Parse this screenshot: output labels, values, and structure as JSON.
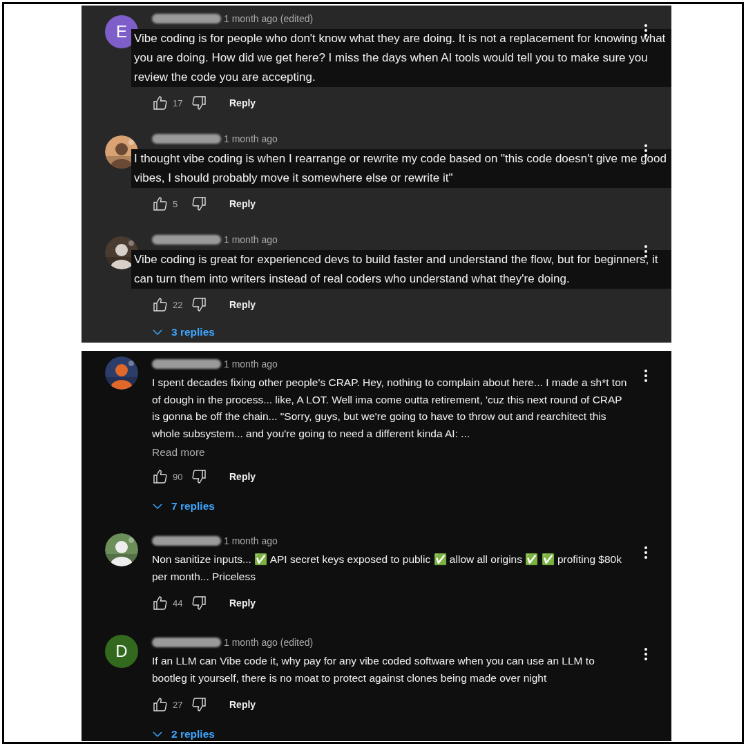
{
  "panels": [
    {
      "kind": "highlighted",
      "comments": [
        {
          "avatar": {
            "kind": "letter",
            "letter": "E",
            "color": "#7e5fc9"
          },
          "time": "1 month ago (edited)",
          "text": "Vibe coding is for people who don't know what they are doing. It is not a replacement for knowing what you are doing. How did we get here? I miss the days when AI tools would tell you to make sure you review the code you are accepting.",
          "likes": "17",
          "reply": "Reply"
        },
        {
          "time": "1 month ago",
          "text": "I thought vibe coding is when I rearrange or rewrite my code based on \"this code doesn't give me good vibes, I should probably move it somewhere else or rewrite it\"",
          "likes": "5",
          "reply": "Reply"
        },
        {
          "time": "1 month ago",
          "text": "Vibe coding is great for experienced devs to build faster and understand the flow, but for beginners, it can turn them into writers instead of real coders who understand what they're doing.",
          "likes": "22",
          "reply": "Reply",
          "replies": "3 replies"
        }
      ]
    },
    {
      "kind": "plain",
      "comments": [
        {
          "time": "1 month ago",
          "text": "I spent decades fixing other people's CRAP. Hey, nothing to complain about here... I made a sh*t ton of dough in the process... like, A LOT. Well ima come outta retirement, 'cuz this next round of CRAP is gonna be off the chain... \"Sorry, guys, but we're going to have to throw out and rearchitect this whole subsystem... and you're going to need a different kinda AI: ...",
          "read_more": "Read more",
          "likes": "90",
          "reply": "Reply",
          "replies": "7 replies"
        },
        {
          "time": "1 month ago",
          "text": "Non sanitize inputs... ✅ API secret keys exposed to public ✅ allow all origins ✅ ✅ profiting $80k per month... Priceless",
          "likes": "44",
          "reply": "Reply"
        },
        {
          "avatar": {
            "kind": "letter",
            "letter": "D",
            "color": "#33691e"
          },
          "time": "1 month ago (edited)",
          "text": "If an LLM can Vibe code it, why pay for any vibe coded software when you can use an LLM to bootleg it yourself, there is no moat to protect against clones being made over night",
          "likes": "27",
          "reply": "Reply",
          "replies": "2 replies"
        }
      ]
    }
  ]
}
